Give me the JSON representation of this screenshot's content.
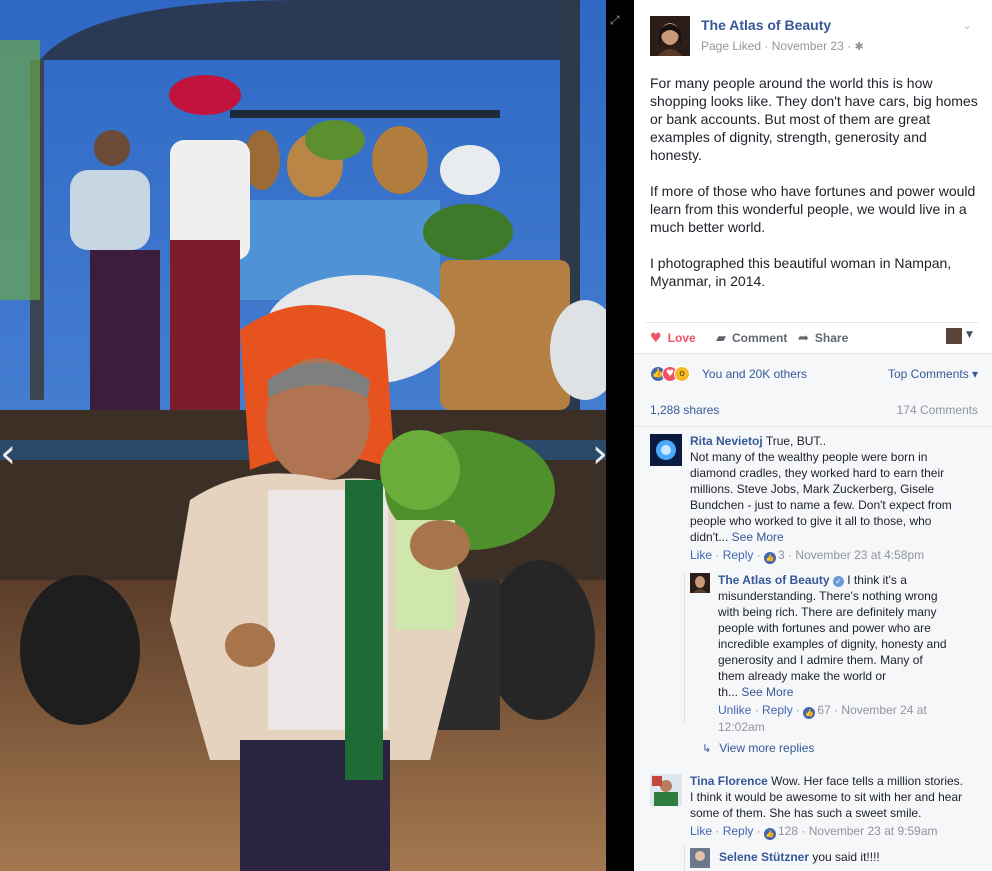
{
  "photo": {
    "prev_icon": "chevron-left-icon",
    "next_icon": "chevron-right-icon",
    "expand_icon": "expand-icon",
    "glyphs": {
      "prev": "‹",
      "next": "›",
      "expand": "⤢"
    }
  },
  "post": {
    "page_name": "The Atlas of Beauty",
    "status": "Page Liked",
    "date": "November 23",
    "privacy_icon": "gear-icon",
    "paragraphs": [
      "For many people around the world this is how shopping looks like. They don't have cars, big homes or bank accounts. But most of them are great examples of dignity, strength, generosity and honesty.",
      "If more of those who have fortunes and power would learn from this wonderful people, we would live in a much better world.",
      "I photographed this beautiful woman in Nampan, Myanmar, in 2014."
    ]
  },
  "actions": {
    "love": "Love",
    "comment": "Comment",
    "share": "Share",
    "love_color": "#f25268"
  },
  "reactions": {
    "summary": "You and 20K others",
    "sort": "Top Comments",
    "shares": "1,288 shares",
    "comments": "174 Comments",
    "icons": [
      "like-icon",
      "love-icon",
      "wow-icon"
    ]
  },
  "comments": [
    {
      "name": "Rita Nevietoj",
      "lines": [
        "True, BUT..",
        "Not many of the wealthy people were born in",
        "diamond cradles, they worked hard to earn their",
        "millions. Steve Jobs, Mark Zuckerberg, Gisele",
        "Bundchen - just to name a few. Don't expect from",
        "people who worked to give it all to those, who",
        "didn't..."
      ],
      "see_more": "See More",
      "like": "Like",
      "reply": "Reply",
      "likes": "3",
      "time": "November 23 at 4:58pm"
    },
    {
      "name": "The Atlas of Beauty",
      "lines": [
        "I think it's a",
        "misunderstanding. There's nothing wrong",
        "with being rich. There are definitely many",
        "people with fortunes and power who are",
        "incredible examples of dignity, honesty and",
        "generosity and I admire them. Many of",
        "them already make the world or",
        "th..."
      ],
      "see_more": "See More",
      "like": "Unlike",
      "reply": "Reply",
      "likes": "67",
      "time": "November 24 at",
      "time2": "12:02am"
    },
    {
      "name": "Tina Florence",
      "lines": [
        "Wow. Her face tells a million stories.",
        "I think it would be awesome to sit with her and hear",
        "some of them. She has such a sweet smile."
      ],
      "like": "Like",
      "reply": "Reply",
      "likes": "128",
      "time": "November 23 at 9:59am"
    },
    {
      "name": "Selene Stützner",
      "text": "you said it!!!!"
    }
  ],
  "view_more_replies": "View more replies",
  "colors": {
    "link": "#365899",
    "meta": "#90949c",
    "panel_bg": "#f6f7f9"
  }
}
